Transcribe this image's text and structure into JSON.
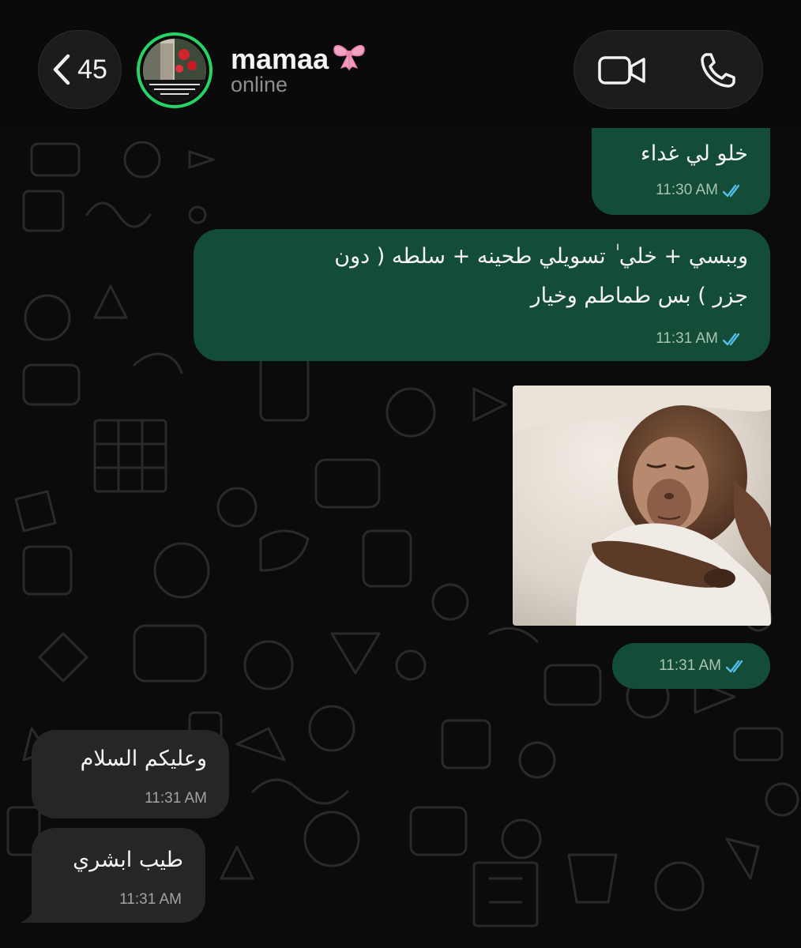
{
  "header": {
    "back_count": "45",
    "contact_name": "mamaa",
    "contact_emoji": "🎀",
    "status": "online",
    "icons": {
      "back": "chevron-left-icon",
      "video": "video-camera-icon",
      "voice": "phone-icon",
      "ribbon": "ribbon-icon"
    }
  },
  "messages": [
    {
      "direction": "outgoing",
      "text": "خلو لي غداء",
      "time": "11:30 AM",
      "status": "read"
    },
    {
      "direction": "outgoing",
      "lines": [
        "وببسي + خلي ٰ       تسويلي طحينه + سلطه ( دون",
        "جزر ) بس طماطم وخيار"
      ],
      "time": "11:31 AM",
      "status": "read"
    },
    {
      "direction": "outgoing",
      "type": "image",
      "image_desc": "sleeping-monkey-photo",
      "time": "11:31 AM",
      "status": "read"
    },
    {
      "direction": "incoming",
      "text": "وعليكم السلام",
      "time": "11:31 AM"
    },
    {
      "direction": "incoming",
      "text": "طيب ابشري",
      "time": "11:31 AM"
    }
  ],
  "colors": {
    "background": "#0b0b0b",
    "outgoing_bubble": "#134d37",
    "incoming_bubble": "#262626",
    "read_ticks": "#53bdeb",
    "online_ring": "#25d366"
  }
}
